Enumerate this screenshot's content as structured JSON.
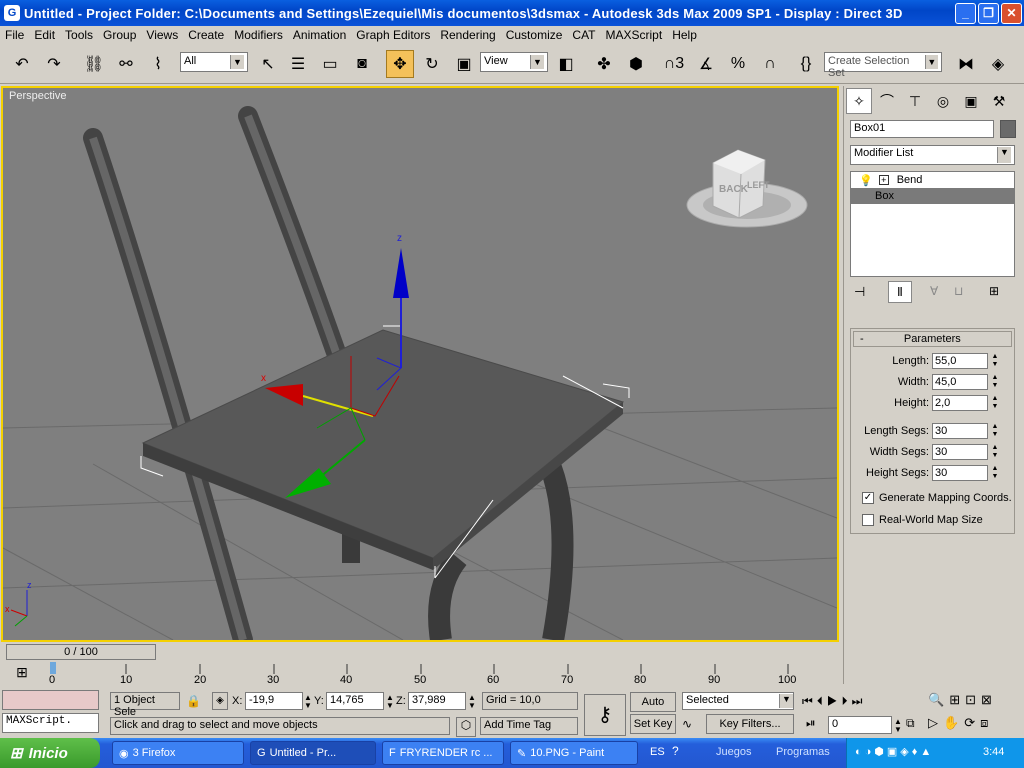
{
  "window": {
    "title": "Untitled    - Project Folder: C:\\Documents and Settings\\Ezequiel\\Mis documentos\\3dsmax    - Autodesk 3ds Max  2009 SP1    - Display : Direct 3D",
    "minimize_glyph": "_",
    "maximize_glyph": "❐",
    "close_glyph": "✕"
  },
  "menu": [
    "File",
    "Edit",
    "Tools",
    "Group",
    "Views",
    "Create",
    "Modifiers",
    "Animation",
    "Graph Editors",
    "Rendering",
    "Customize",
    "CAT",
    "MAXScript",
    "Help"
  ],
  "toolbar": {
    "selection_filter": "All",
    "reference_coord": "View",
    "named_selection_placeholder": "Create Selection Set"
  },
  "viewport": {
    "label": "Perspective",
    "viewcube_face_front": "BACK",
    "viewcube_face_side": "LEFT",
    "gizmo_z": "z",
    "gizmo_x": "x",
    "axis_z": "z",
    "axis_x": "x"
  },
  "command_panel": {
    "object_name": "Box01",
    "modifier_list_label": "Modifier List",
    "modifier_stack": [
      {
        "label": "Bend",
        "selected": false
      },
      {
        "label": "Box",
        "selected": true
      }
    ],
    "rollout_title": "Parameters",
    "params": [
      {
        "label": "Length:",
        "value": "55,0"
      },
      {
        "label": "Width:",
        "value": "45,0"
      },
      {
        "label": "Height:",
        "value": "2,0"
      },
      {
        "label": "Length Segs:",
        "value": "30"
      },
      {
        "label": "Width Segs:",
        "value": "30"
      },
      {
        "label": "Height Segs:",
        "value": "30"
      }
    ],
    "checkboxes": [
      {
        "label": "Generate Mapping Coords.",
        "checked": true,
        "mark": "✓"
      },
      {
        "label": "Real-World Map Size",
        "checked": false,
        "mark": ""
      }
    ]
  },
  "timeline": {
    "slider_label": "0 / 100",
    "ticks": [
      "0",
      "10",
      "20",
      "30",
      "40",
      "50",
      "60",
      "70",
      "80",
      "90",
      "100"
    ]
  },
  "status": {
    "maxscript_label": "MAXScript.",
    "selection_count": "1 Object Sele",
    "x_label": "X:",
    "x_value": "-19,9",
    "y_label": "Y:",
    "y_value": "14,765",
    "z_label": "Z:",
    "z_value": "37,989",
    "grid": "Grid = 10,0",
    "prompt": "Click and drag to select and move objects",
    "add_time_tag": "Add Time Tag",
    "auto_key": "Auto Key",
    "set_key": "Set Key",
    "key_mode": "Selected",
    "key_filters": "Key Filters...",
    "frame": "0"
  },
  "taskbar": {
    "start_label": "Inicio",
    "tasks": [
      "3 Firefox",
      "Untitled   - Pr...",
      "FRYRENDER rc ...",
      "10.PNG - Paint"
    ],
    "lang": "ES",
    "tray_juegos": "Juegos",
    "tray_programas": "Programas",
    "clock": "3:44"
  },
  "colors": {
    "viewport_bg": "#7f7f7f",
    "active_border": "#f4d000",
    "selected_modifier": "#7a7a7a",
    "title_blue": "#0046c8"
  }
}
